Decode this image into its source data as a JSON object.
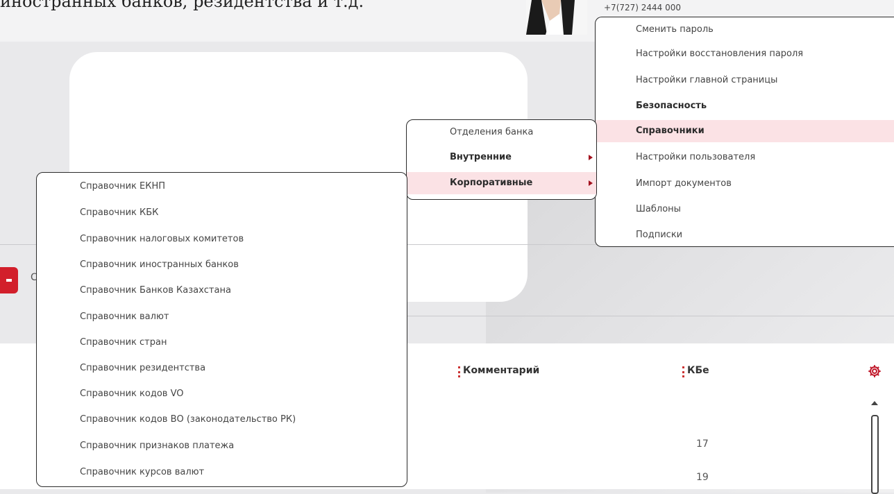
{
  "top_text": "иностранных банков, резидентства и т.д.",
  "header": {
    "phone": "+7(727) 2444 000"
  },
  "left_button": {
    "label": "С"
  },
  "main_menu": {
    "items": [
      {
        "label": "Сменить пароль"
      },
      {
        "label": "Настройки восстановления пароля"
      },
      {
        "label": "Настройки главной страницы"
      },
      {
        "label": "Безопасность"
      },
      {
        "label": "Справочники"
      },
      {
        "label": "Настройки пользователя"
      },
      {
        "label": "Импорт документов"
      },
      {
        "label": "Шаблоны"
      },
      {
        "label": "Подписки"
      }
    ]
  },
  "sub_menu_1": {
    "items": [
      {
        "label": "Отделения банка"
      },
      {
        "label": "Внутренние"
      },
      {
        "label": "Корпоративные"
      }
    ]
  },
  "sub_menu_2": {
    "items": [
      {
        "label": "Справочник ЕКНП"
      },
      {
        "label": "Справочник КБК"
      },
      {
        "label": "Справочник налоговых комитетов"
      },
      {
        "label": "Справочник иностранных банков"
      },
      {
        "label": "Справочник Банков Казахстана"
      },
      {
        "label": "Справочник валют"
      },
      {
        "label": "Справочник стран"
      },
      {
        "label": "Справочник резидентства"
      },
      {
        "label": "Справочник кодов VO"
      },
      {
        "label": "Справочник кодов ВО (законодательство РК)"
      },
      {
        "label": "Справочник признаков платежа"
      },
      {
        "label": "Справочник курсов валют"
      }
    ]
  },
  "table": {
    "columns": [
      {
        "label": "Комментарий"
      },
      {
        "label": "КБе"
      }
    ],
    "rows": [
      {
        "kbe": "17"
      },
      {
        "kbe": "19"
      }
    ]
  },
  "colors": {
    "accent": "#d21f2b",
    "highlight": "#fbe2e5",
    "arrow": "#a3111e"
  },
  "icons": [
    "gear-icon",
    "chevron-right-icon",
    "scroll-up-icon"
  ]
}
